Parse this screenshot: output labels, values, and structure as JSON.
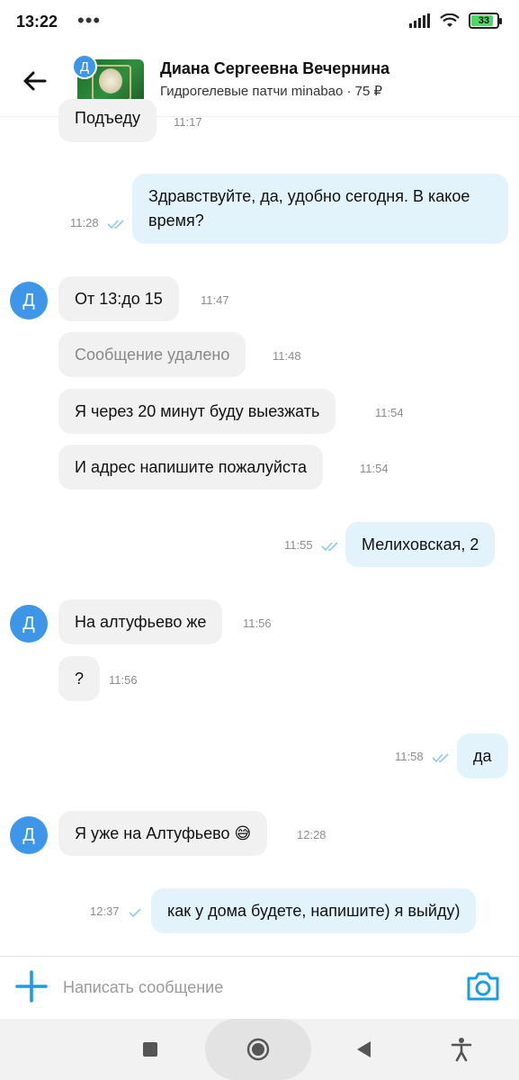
{
  "status_bar": {
    "time": "13:22",
    "dots": "•••",
    "battery": "33"
  },
  "header": {
    "avatar_letter": "Д",
    "name": "Диана Сергеевна Вечернина",
    "subtitle": "Гидрогелевые патчи minabao · 75 ₽"
  },
  "messages": [
    {
      "dir": "in",
      "text": "Подъеду",
      "time": "11:17"
    },
    {
      "dir": "out",
      "text": "Здравствуйте, да, удобно сегодня. В какое время?",
      "time": "11:28"
    },
    {
      "dir": "in",
      "text": "От 13:до 15",
      "time": "11:47"
    },
    {
      "dir": "in",
      "text": "Сообщение удалено",
      "time": "11:48",
      "deleted": true
    },
    {
      "dir": "in",
      "text": "Я через 20 минут буду выезжать",
      "time": "11:54"
    },
    {
      "dir": "in",
      "text": "И адрес напишите пожалуйста",
      "time": "11:54"
    },
    {
      "dir": "out",
      "text": "Мелиховская, 2",
      "time": "11:55"
    },
    {
      "dir": "in",
      "text": "На алтуфьево же",
      "time": "11:56"
    },
    {
      "dir": "in",
      "text": "?",
      "time": "11:56"
    },
    {
      "dir": "out",
      "text": "да",
      "time": "11:58"
    },
    {
      "dir": "in",
      "text": "Я уже на Алтуфьево 😅",
      "time": "12:28"
    },
    {
      "dir": "out",
      "text": "как у дома будете, напишите) я выйду)",
      "time": "12:37"
    }
  ],
  "avatar_letter": "Д",
  "composer": {
    "placeholder": "Написать сообщение"
  },
  "colors": {
    "accent": "#1a9be6",
    "outgoing_bubble": "#e3f3fc",
    "incoming_bubble": "#f1f1f1",
    "avatar": "#3d96e8",
    "read_check": "#8ec9ef"
  }
}
